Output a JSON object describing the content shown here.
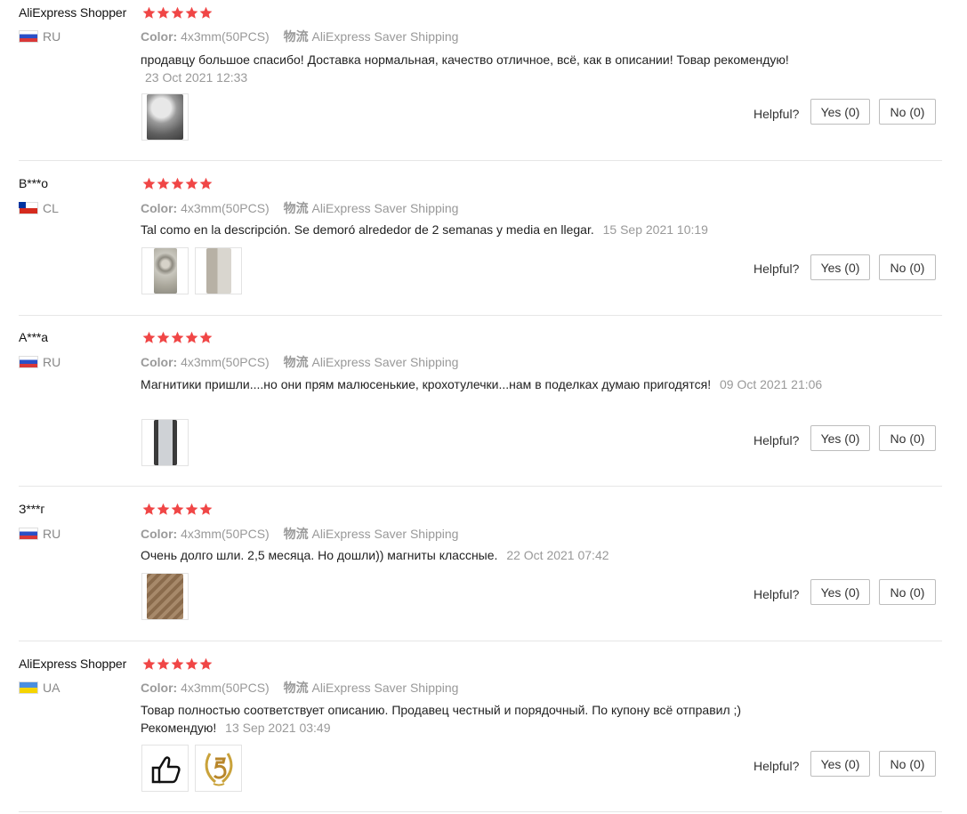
{
  "colors": {
    "star": "#f04646",
    "divider": "#e6e6e6",
    "meta_text": "#999999"
  },
  "common": {
    "color_label": "Color:",
    "shipping_label": "物流",
    "helpful_label": "Helpful?"
  },
  "reviews": [
    {
      "user": "AliExpress Shopper",
      "country": "RU",
      "flag": "ru",
      "rating": 5,
      "color_value": "4x3mm(50PCS)",
      "shipping_value": "AliExpress Saver Shipping",
      "text": "продавцу большое спасибо! Доставка нормальная, качество отличное, всё, как в описании! Товар рекомендую!",
      "date": "23 Oct 2021 12:33",
      "photos": [
        "photo"
      ],
      "yes": "Yes (0)",
      "no": "No (0)"
    },
    {
      "user": "B***o",
      "country": "CL",
      "flag": "cl",
      "rating": 5,
      "color_value": "4x3mm(50PCS)",
      "shipping_value": "AliExpress Saver Shipping",
      "text": "Tal como en la descripción. Se demoró alrededor de 2 semanas y media en llegar.",
      "date": "15 Sep 2021 10:19",
      "photos": [
        "photo",
        "photo"
      ],
      "yes": "Yes (0)",
      "no": "No (0)"
    },
    {
      "user": "A***a",
      "country": "RU",
      "flag": "ru",
      "rating": 5,
      "color_value": "4x3mm(50PCS)",
      "shipping_value": "AliExpress Saver Shipping",
      "text": "Магнитики пришли....но они прям малюсенькие, крохотулечки...нам в поделках думаю пригодятся!",
      "date": "09 Oct 2021 21:06",
      "photos": [
        "photo"
      ],
      "yes": "Yes (0)",
      "no": "No (0)"
    },
    {
      "user": "З***г",
      "country": "RU",
      "flag": "ru",
      "rating": 5,
      "color_value": "4x3mm(50PCS)",
      "shipping_value": "AliExpress Saver Shipping",
      "text": "Очень долго шли. 2,5 месяца. Но дошли)) магниты классные.",
      "date": "22 Oct 2021 07:42",
      "photos": [
        "photo"
      ],
      "yes": "Yes (0)",
      "no": "No (0)"
    },
    {
      "user": "AliExpress Shopper",
      "country": "UA",
      "flag": "ua",
      "rating": 5,
      "color_value": "4x3mm(50PCS)",
      "shipping_value": "AliExpress Saver Shipping",
      "text": "Товар полностью соответствует описанию. Продавец честный и порядочный. По купону всё отправил ;) Рекомендую!",
      "date": "13 Sep 2021 03:49",
      "photos": [
        "thumbs-up-icon",
        "laurel-five-icon"
      ],
      "yes": "Yes (0)",
      "no": "No (0)"
    }
  ]
}
